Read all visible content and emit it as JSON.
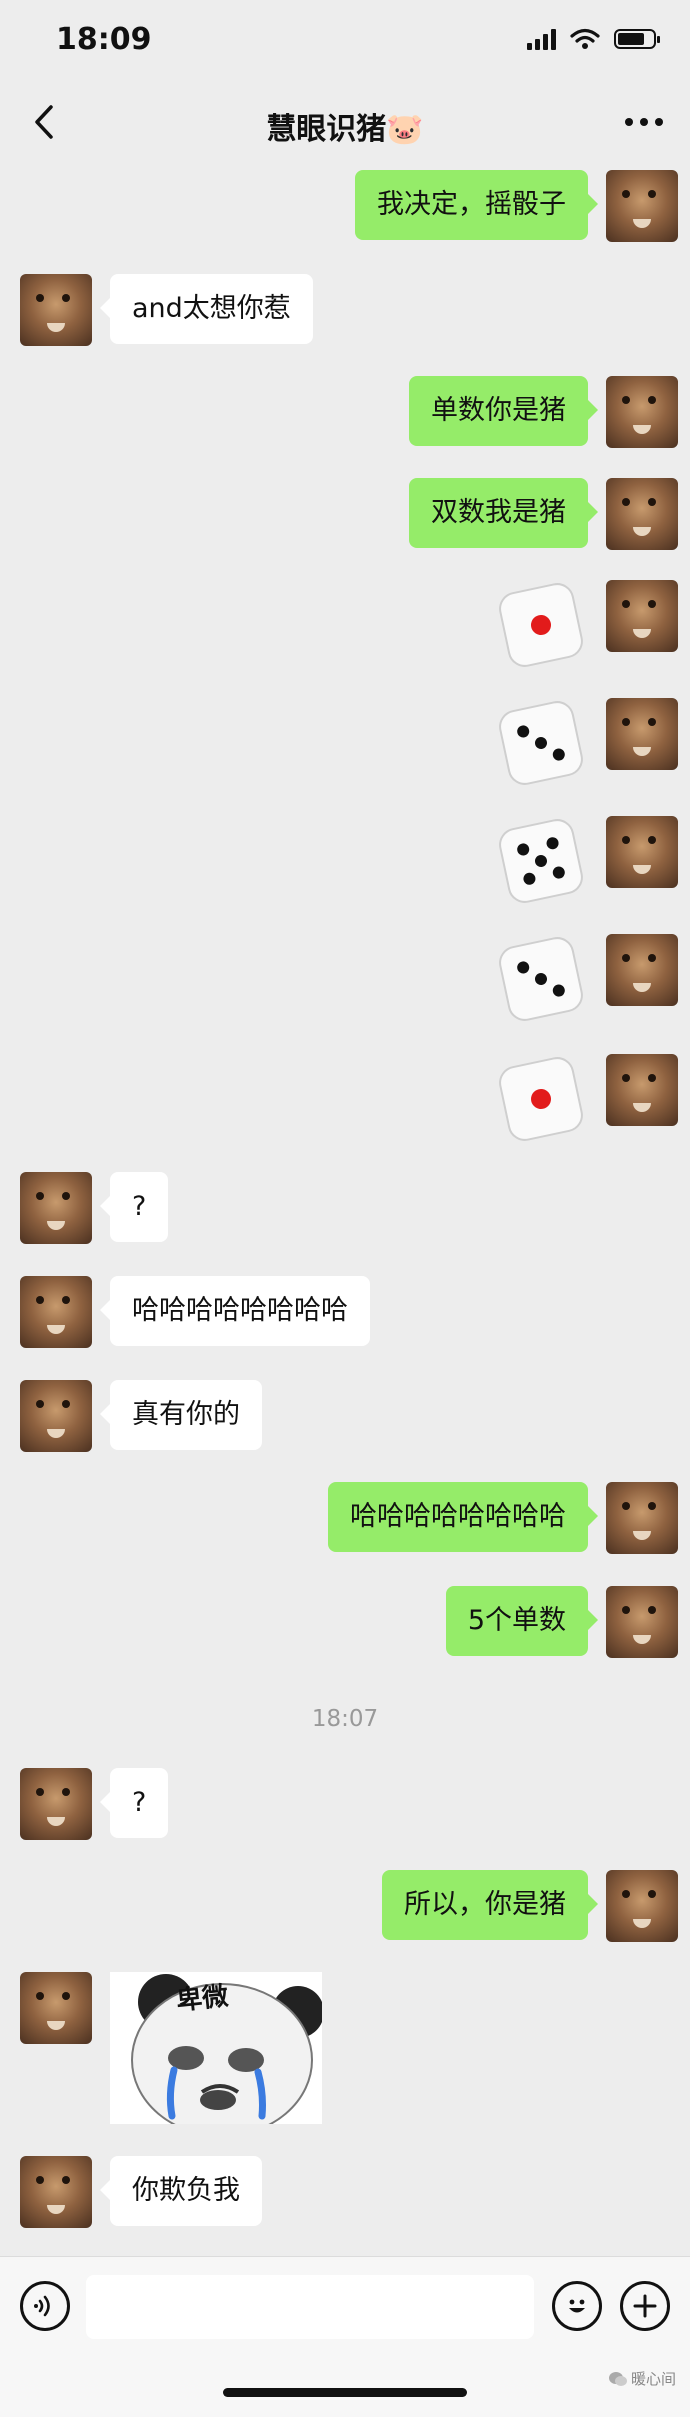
{
  "status_bar": {
    "time": "18:09"
  },
  "nav": {
    "title": "慧眼识猪🐷"
  },
  "messages": {
    "m1": "我决定，摇骰子",
    "m2": "and太想你惹",
    "m3": "单数你是猪",
    "m4": "双数我是猪",
    "m10": "?",
    "m11": "哈哈哈哈哈哈哈哈",
    "m12": "真有你的",
    "m13": "哈哈哈哈哈哈哈哈",
    "m14": "5个单数",
    "m15": "?",
    "m16": "所以，你是猪",
    "m18": "你欺负我"
  },
  "dice_rolls": [
    1,
    3,
    5,
    3,
    1
  ],
  "timestamp": "18:07",
  "sticker": {
    "text": "卑微"
  },
  "watermark": "暖心间",
  "colors": {
    "outgoing_bubble": "#95ec69",
    "incoming_bubble": "#ffffff",
    "background": "#ededed"
  },
  "icons": [
    "back-icon",
    "more-icon",
    "voice-icon",
    "emoji-icon",
    "add-icon"
  ]
}
